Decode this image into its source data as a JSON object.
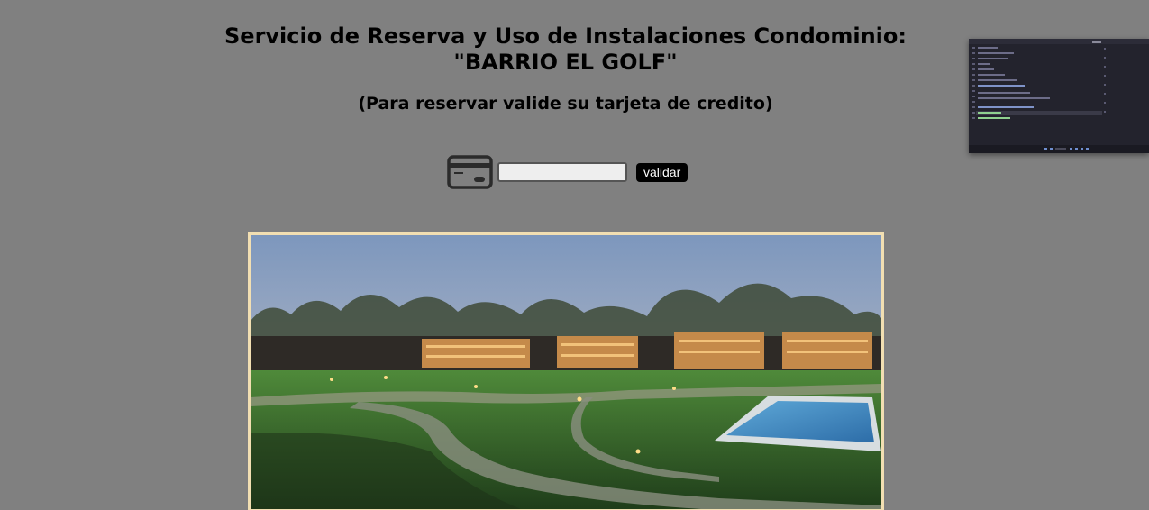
{
  "header": {
    "title_line1": "Servicio de Reserva y Uso de Instalaciones Condominio:",
    "title_line2": "\"BARRIO EL GOLF\"",
    "subtitle": "(Para reservar valide su tarjeta de credito)"
  },
  "card_form": {
    "icon": "credit-card-icon",
    "input_value": "",
    "button_label": "validar"
  },
  "photo": {
    "subject": "condominium-photo",
    "frame_color": "#f2dfb2"
  },
  "thumbnail": {
    "subject": "code-editor-window-thumbnail"
  }
}
